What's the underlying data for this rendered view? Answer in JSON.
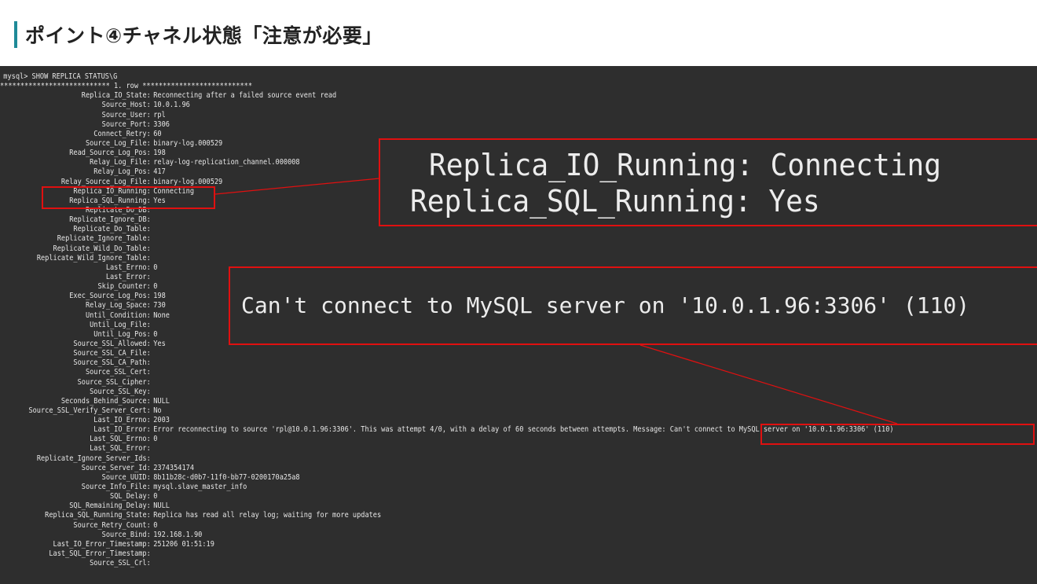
{
  "slide": {
    "title": "ポイント④チャネル状態「注意が必要」"
  },
  "terminal": {
    "prompt": "mysql> SHOW REPLICA STATUS\\G",
    "row_header": "*************************** 1. row ***************************",
    "fields": [
      {
        "key": "Replica_IO_State",
        "value": "Reconnecting after a failed source event read"
      },
      {
        "key": "Source_Host",
        "value": "10.0.1.96"
      },
      {
        "key": "Source_User",
        "value": "rpl"
      },
      {
        "key": "Source_Port",
        "value": "3306"
      },
      {
        "key": "Connect_Retry",
        "value": "60"
      },
      {
        "key": "Source_Log_File",
        "value": "binary-log.000529"
      },
      {
        "key": "Read_Source_Log_Pos",
        "value": "198"
      },
      {
        "key": "Relay_Log_File",
        "value": "relay-log-replication_channel.000008"
      },
      {
        "key": "Relay_Log_Pos",
        "value": "417"
      },
      {
        "key": "Relay_Source_Log_File",
        "value": "binary-log.000529"
      },
      {
        "key": "Replica_IO_Running",
        "value": "Connecting"
      },
      {
        "key": "Replica_SQL_Running",
        "value": "Yes"
      },
      {
        "key": "Replicate_Do_DB",
        "value": ""
      },
      {
        "key": "Replicate_Ignore_DB",
        "value": ""
      },
      {
        "key": "Replicate_Do_Table",
        "value": ""
      },
      {
        "key": "Replicate_Ignore_Table",
        "value": ""
      },
      {
        "key": "Replicate_Wild_Do_Table",
        "value": ""
      },
      {
        "key": "Replicate_Wild_Ignore_Table",
        "value": ""
      },
      {
        "key": "Last_Errno",
        "value": "0"
      },
      {
        "key": "Last_Error",
        "value": ""
      },
      {
        "key": "Skip_Counter",
        "value": "0"
      },
      {
        "key": "Exec_Source_Log_Pos",
        "value": "198"
      },
      {
        "key": "Relay_Log_Space",
        "value": "730"
      },
      {
        "key": "Until_Condition",
        "value": "None"
      },
      {
        "key": "Until_Log_File",
        "value": ""
      },
      {
        "key": "Until_Log_Pos",
        "value": "0"
      },
      {
        "key": "Source_SSL_Allowed",
        "value": "Yes"
      },
      {
        "key": "Source_SSL_CA_File",
        "value": ""
      },
      {
        "key": "Source_SSL_CA_Path",
        "value": ""
      },
      {
        "key": "Source_SSL_Cert",
        "value": ""
      },
      {
        "key": "Source_SSL_Cipher",
        "value": ""
      },
      {
        "key": "Source_SSL_Key",
        "value": ""
      },
      {
        "key": "Seconds_Behind_Source",
        "value": "NULL"
      },
      {
        "key": "Source_SSL_Verify_Server_Cert",
        "value": "No"
      },
      {
        "key": "Last_IO_Errno",
        "value": "2003"
      },
      {
        "key": "Last_IO_Error",
        "value": "Error reconnecting to source 'rpl@10.0.1.96:3306'. This was attempt 4/0, with a delay of 60 seconds between attempts. Message: Can't connect to MySQL server on '10.0.1.96:3306' (110)"
      },
      {
        "key": "Last_SQL_Errno",
        "value": "0"
      },
      {
        "key": "Last_SQL_Error",
        "value": ""
      },
      {
        "key": "Replicate_Ignore_Server_Ids",
        "value": ""
      },
      {
        "key": "Source_Server_Id",
        "value": "2374354174"
      },
      {
        "key": "Source_UUID",
        "value": "8b11b28c-d0b7-11f0-bb77-0200170a25a8"
      },
      {
        "key": "Source_Info_File",
        "value": "mysql.slave_master_info"
      },
      {
        "key": "SQL_Delay",
        "value": "0"
      },
      {
        "key": "SQL_Remaining_Delay",
        "value": "NULL"
      },
      {
        "key": "Replica_SQL_Running_State",
        "value": "Replica has read all relay log; waiting for more updates"
      },
      {
        "key": "Source_Retry_Count",
        "value": "0"
      },
      {
        "key": "Source_Bind",
        "value": "192.168.1.90"
      },
      {
        "key": "Last_IO_Error_Timestamp",
        "value": "251206 01:51:19"
      },
      {
        "key": "Last_SQL_Error_Timestamp",
        "value": ""
      },
      {
        "key": "Source_SSL_Crl",
        "value": ""
      }
    ]
  },
  "callouts": {
    "running_zoom": {
      "line1": "Replica_IO_Running: Connecting",
      "line2": "Replica_SQL_Running: Yes"
    },
    "error_zoom": {
      "text": "Can't connect to MySQL server on '10.0.1.96:3306' (110)"
    },
    "highlight_color": "#e01010"
  }
}
